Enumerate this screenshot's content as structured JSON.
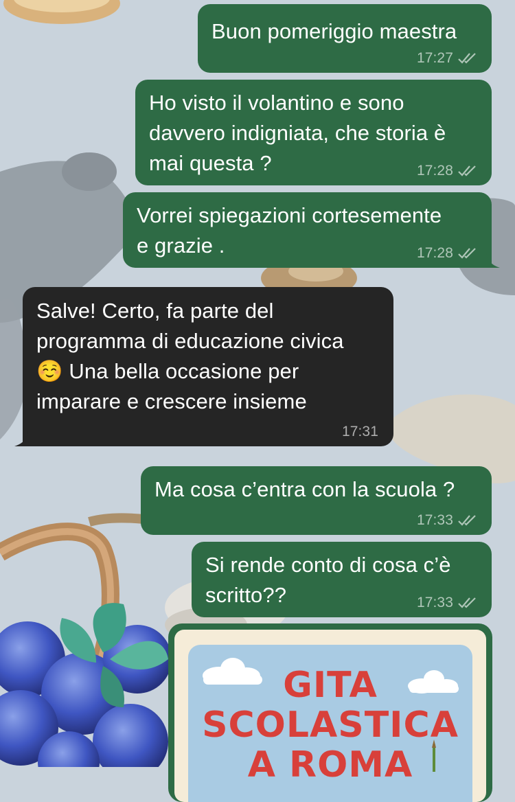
{
  "colors": {
    "outgoing_bubble": "#2e6b45",
    "incoming_bubble": "#252525",
    "wallpaper": "#c9d3dc",
    "poster_title": "#d8403a"
  },
  "messages": [
    {
      "direction": "outgoing",
      "text": "Buon pomeriggio maestra",
      "time": "17:27",
      "status": "double-check-icon"
    },
    {
      "direction": "outgoing",
      "text": "Ho visto il volantino e sono\ndavvero indigniata, che storia è\nmai questa ?",
      "time": "17:28",
      "status": "double-check-icon"
    },
    {
      "direction": "outgoing",
      "text": "Vorrei spiegazioni cortesemente\ne grazie .",
      "time": "17:28",
      "status": "double-check-icon"
    },
    {
      "direction": "incoming",
      "text": "Salve! Certo, fa parte del\nprogramma di educazione civica\n☺️ Una bella occasione per\nimparare e crescere insieme",
      "time": "17:31"
    },
    {
      "direction": "outgoing",
      "text": "Ma cosa c’entra con la scuola ?",
      "time": "17:33",
      "status": "double-check-icon"
    },
    {
      "direction": "outgoing",
      "text": "Si rende conto di cosa c’è\nscritto??",
      "time": "17:33",
      "status": "double-check-icon"
    }
  ],
  "image_message": {
    "title_lines": [
      "GITA",
      "SCOLASTICA",
      "A ROMA"
    ]
  }
}
